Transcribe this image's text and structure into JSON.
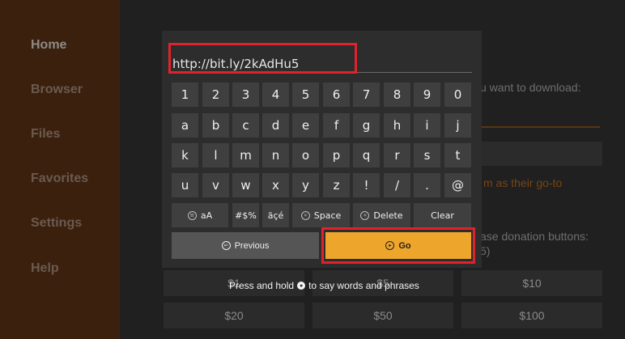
{
  "sidebar": {
    "items": [
      {
        "label": "Home"
      },
      {
        "label": "Browser"
      },
      {
        "label": "Files"
      },
      {
        "label": "Favorites"
      },
      {
        "label": "Settings"
      },
      {
        "label": "Help"
      }
    ]
  },
  "background": {
    "prompt_tail": "u want to download:",
    "orange_tail": "m as their go-to",
    "donation_tail": "ase donation buttons:",
    "donation_paren": "5)",
    "buttons": [
      {
        "label": "$1"
      },
      {
        "label": "$5"
      },
      {
        "label": "$10"
      },
      {
        "label": "$20"
      },
      {
        "label": "$50"
      },
      {
        "label": "$100"
      }
    ]
  },
  "keyboard": {
    "url_value": "http://bit.ly/2kAdHu5",
    "row1": [
      "1",
      "2",
      "3",
      "4",
      "5",
      "6",
      "7",
      "8",
      "9",
      "0"
    ],
    "row2": [
      "a",
      "b",
      "c",
      "d",
      "e",
      "f",
      "g",
      "h",
      "i",
      "j"
    ],
    "row3": [
      "k",
      "l",
      "m",
      "n",
      "o",
      "p",
      "q",
      "r",
      "s",
      "t"
    ],
    "row4": [
      "u",
      "v",
      "w",
      "x",
      "y",
      "z",
      "!",
      "/",
      ".",
      "@"
    ],
    "case_label": "aA",
    "symbols_label": "#$%",
    "accents_label": "äçé",
    "space_label": "Space",
    "delete_label": "Delete",
    "clear_label": "Clear",
    "previous_label": "Previous",
    "go_label": "Go"
  },
  "hint": {
    "before": "Press and hold",
    "after": "to say words and phrases"
  },
  "colors": {
    "highlight": "#e0222a",
    "go_button": "#eea52b",
    "sidebar": "#3b200e"
  }
}
